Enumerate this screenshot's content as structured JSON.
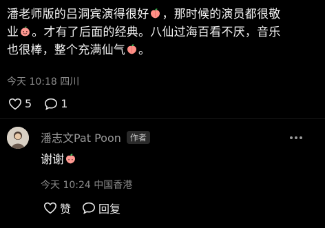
{
  "comment": {
    "line1": "潘老师版的吕洞宾演得很好",
    "line1b": "，那时候的演员都很敬",
    "line2a": "业",
    "line2b": "。才有了后面的经典。八仙过海百看不厌，音乐",
    "line3a": "也很棒，整个充满仙气",
    "line3b": "。",
    "meta": "今天 10:18 四川",
    "like_count": "5",
    "reply_count": "1"
  },
  "reply": {
    "author": "潘志文Pat Poon",
    "badge": "作者",
    "text": "谢谢",
    "meta": "今天 10:24 中国香港",
    "like_label": "赞",
    "reply_label": "回复"
  },
  "icons": {
    "emoji": "peach-emoji-icon",
    "like": "heart-icon",
    "comment": "comment-bubble-icon",
    "more": "more-dots-icon"
  },
  "colors": {
    "background": "#000000",
    "text": "#f2f2f2",
    "meta": "#8a8a8a",
    "author": "#9a9a9a"
  }
}
